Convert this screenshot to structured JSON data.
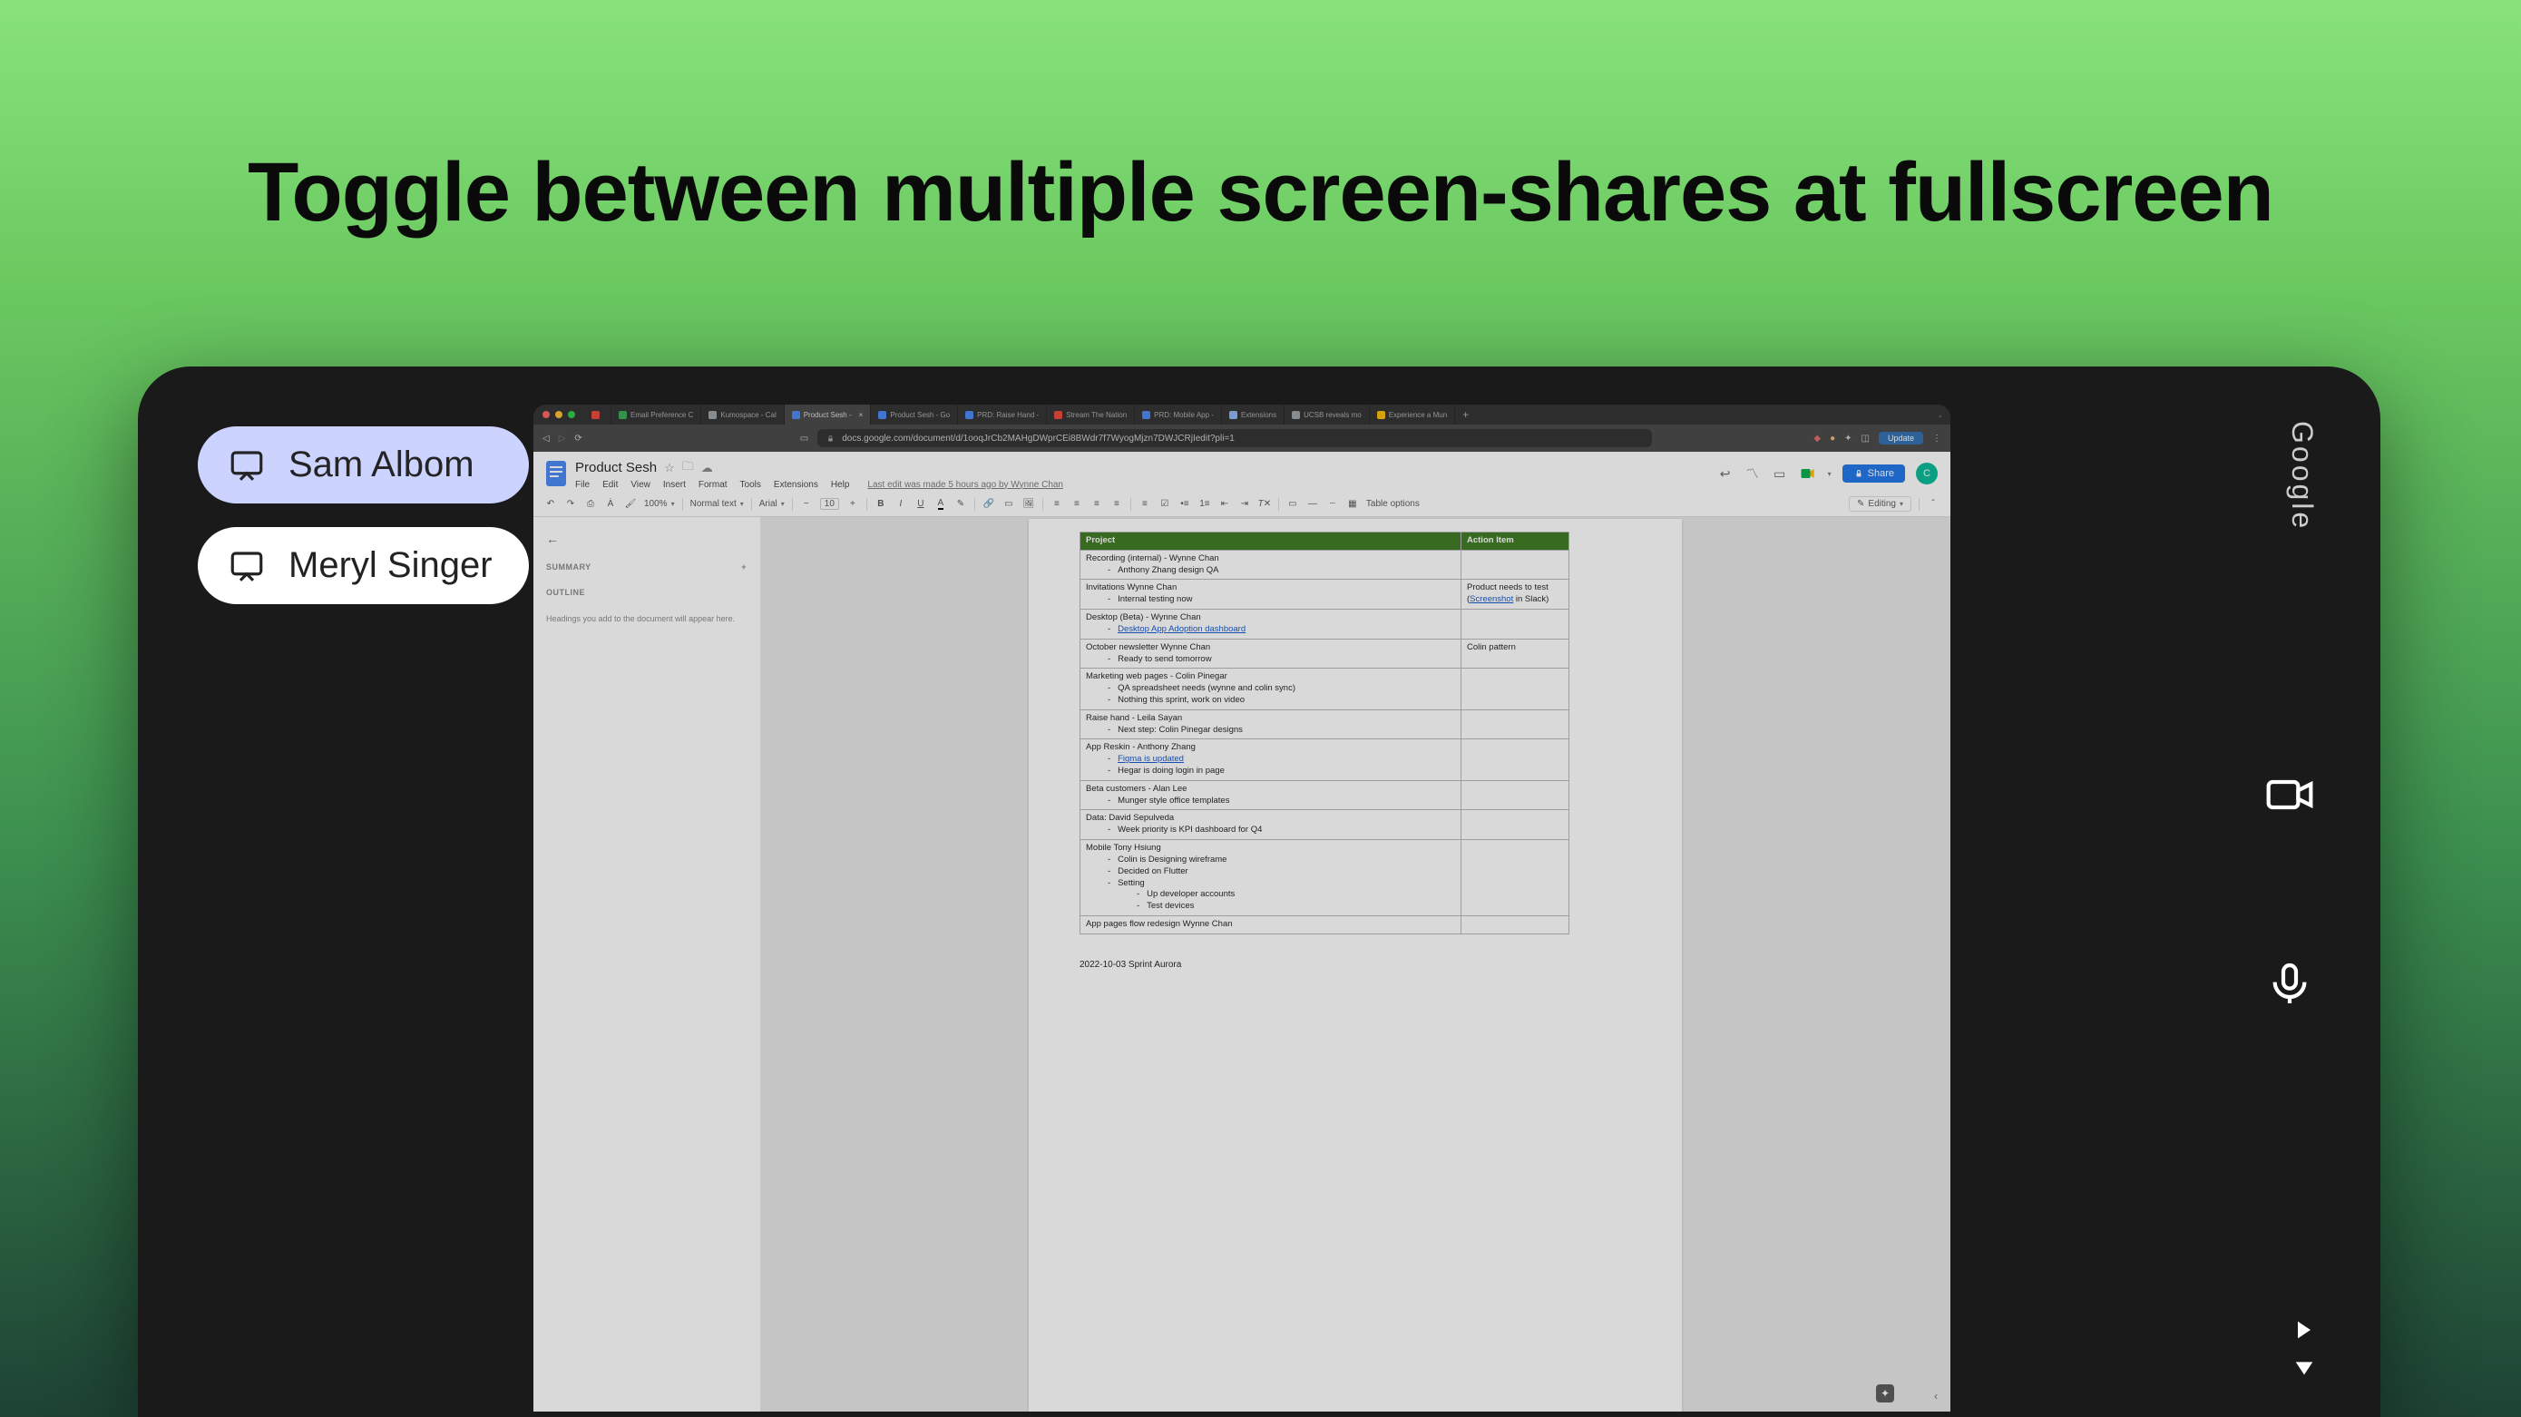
{
  "headline": "Toggle between multiple screen-shares at fullscreen",
  "brand": "Google",
  "sharers": [
    {
      "name": "Sam Albom",
      "active": true
    },
    {
      "name": "Meryl Singer",
      "active": false
    }
  ],
  "browser_tabs": [
    {
      "label": "",
      "color": "#ea4335"
    },
    {
      "label": "Email Preference C",
      "color": "#34a853"
    },
    {
      "label": "Kumospace - Cal",
      "color": "#9aa0a6"
    },
    {
      "label": "Product Sesh - ",
      "color": "#4285f4",
      "active": true
    },
    {
      "label": "Product Sesh - Go",
      "color": "#4285f4"
    },
    {
      "label": "PRD: Raise Hand -",
      "color": "#4285f4"
    },
    {
      "label": "Stream The Nation",
      "color": "#ea4335"
    },
    {
      "label": "PRD: Mobile App -",
      "color": "#4285f4"
    },
    {
      "label": "Extensions",
      "color": "#8ab4f8"
    },
    {
      "label": "UCSB reveals mo",
      "color": "#9aa0a6"
    },
    {
      "label": "Experience a Mun",
      "color": "#fbbc04"
    }
  ],
  "url": "docs.google.com/document/d/1ooqJrCb2MAHgDWprCEi8BWdr7f7WyogMjzn7DWJCRjIedit?pli=1",
  "update_label": "Update",
  "doc": {
    "title": "Product Sesh",
    "menus": [
      "File",
      "Edit",
      "View",
      "Insert",
      "Format",
      "Tools",
      "Extensions",
      "Help"
    ],
    "last_edit": "Last edit was made 5 hours ago by Wynne Chan",
    "share_label": "Share",
    "avatar_initial": "C",
    "outline": {
      "summary_label": "SUMMARY",
      "outline_label": "OUTLINE",
      "help": "Headings you add to the document will appear here."
    },
    "toolbar": {
      "zoom": "100%",
      "style": "Normal text",
      "font": "Arial",
      "size": "10",
      "editing_label": "Editing",
      "table_options": "Table options"
    },
    "table_header": {
      "project": "Project",
      "action": "Action Item"
    },
    "rows": [
      {
        "project": "Recording (internal) -  Wynne Chan",
        "bullets": [
          "Anthony Zhang design QA"
        ],
        "action": ""
      },
      {
        "project": "Invitations  Wynne Chan",
        "bullets": [
          "Internal testing now"
        ],
        "action_html": "Product needs to test (<a>Screenshot</a> in Slack)"
      },
      {
        "project": "Desktop (Beta) -  Wynne Chan",
        "bullets_html": [
          "<a>Desktop App Adoption dashboard</a>"
        ],
        "action": ""
      },
      {
        "project": "October newsletter  Wynne Chan",
        "bullets": [
          "Ready to send tomorrow"
        ],
        "action": "Colin pattern"
      },
      {
        "project": "Marketing web pages -  Colin Pinegar",
        "bullets": [
          "QA spreadsheet needs (wynne and colin sync)",
          "Nothing this sprint, work on video"
        ],
        "action": ""
      },
      {
        "project": "Raise hand -  Leila Sayan",
        "bullets": [
          "Next step:  Colin Pinegar  designs"
        ],
        "action": ""
      },
      {
        "project": "App Reskin -  Anthony Zhang",
        "bullets_html": [
          "<a>Figma is updated</a>",
          "Hegar is doing login in page"
        ],
        "action": ""
      },
      {
        "project": "Beta customers  -   Alan Lee",
        "bullets": [
          "Munger style office templates"
        ],
        "action": ""
      },
      {
        "project": "Data:  David Sepulveda",
        "bullets": [
          "Week priority is KPI dashboard for Q4"
        ],
        "action": ""
      },
      {
        "project": "Mobile  Tony Hsiung",
        "bullets": [
          "Colin is Designing wireframe",
          "Decided on Flutter",
          "Setting"
        ],
        "subbullets": [
          "Up developer accounts",
          "Test devices"
        ],
        "action": ""
      },
      {
        "project": "App pages flow redesign  Wynne Chan",
        "bullets": [],
        "action": ""
      }
    ],
    "footer": "2022-10-03  Sprint Aurora"
  }
}
